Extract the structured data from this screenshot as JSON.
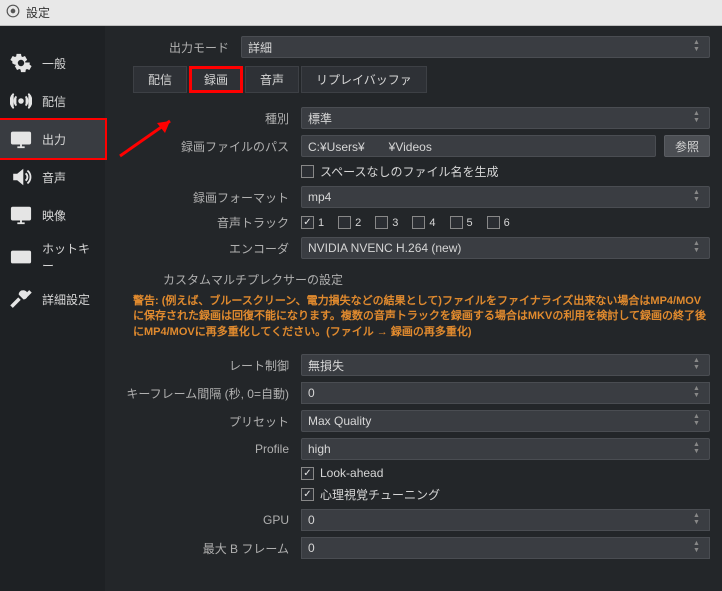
{
  "window": {
    "title": "設定"
  },
  "sidebar": {
    "items": [
      {
        "label": "一般",
        "icon": "gear-icon",
        "key": "general"
      },
      {
        "label": "配信",
        "icon": "broadcast-icon",
        "key": "stream"
      },
      {
        "label": "出力",
        "icon": "output-icon",
        "key": "output",
        "selected": true
      },
      {
        "label": "音声",
        "icon": "speaker-icon",
        "key": "audio"
      },
      {
        "label": "映像",
        "icon": "monitor-icon",
        "key": "video"
      },
      {
        "label": "ホットキー",
        "icon": "keyboard-icon",
        "key": "hotkeys"
      },
      {
        "label": "詳細設定",
        "icon": "tools-icon",
        "key": "advanced"
      }
    ]
  },
  "content": {
    "output_mode_label": "出力モード",
    "output_mode_value": "詳細",
    "tabs": [
      {
        "label": "配信",
        "key": "stream"
      },
      {
        "label": "録画",
        "key": "record",
        "active": true
      },
      {
        "label": "音声",
        "key": "audio"
      },
      {
        "label": "リプレイバッファ",
        "key": "replay"
      }
    ],
    "type_label": "種別",
    "type_value": "標準",
    "path_label": "録画ファイルのパス",
    "path_value": "C:¥Users¥　　¥Videos",
    "browse_label": "参照",
    "spaceless_label": "スペースなしのファイル名を生成",
    "spaceless_checked": false,
    "format_label": "録画フォーマット",
    "format_value": "mp4",
    "track_label": "音声トラック",
    "tracks": [
      {
        "n": "1",
        "on": true
      },
      {
        "n": "2",
        "on": false
      },
      {
        "n": "3",
        "on": false
      },
      {
        "n": "4",
        "on": false
      },
      {
        "n": "5",
        "on": false
      },
      {
        "n": "6",
        "on": false
      }
    ],
    "encoder_label": "エンコーダ",
    "encoder_value": "NVIDIA NVENC H.264 (new)",
    "muxer_section": "カスタムマルチプレクサーの設定",
    "warning_text": "警告: (例えば、ブルースクリーン、電力損失などの結果として)ファイルをファイナライズ出来ない場合はMP4/MOVに保存された録画は回復不能になります。複数の音声トラックを録画する場合はMKVの利用を検討して録画の終了後にMP4/MOVに再多重化してください。(ファイル → 録画の再多重化)",
    "rate_label": "レート制御",
    "rate_value": "無損失",
    "keyint_label": "キーフレーム間隔 (秒, 0=自動)",
    "keyint_value": "0",
    "preset_label": "プリセット",
    "preset_value": "Max Quality",
    "profile_label": "Profile",
    "profile_value": "high",
    "lookahead_label": "Look-ahead",
    "lookahead_checked": true,
    "psycho_label": "心理視覚チューニング",
    "psycho_checked": true,
    "gpu_label": "GPU",
    "gpu_value": "0",
    "bframes_label": "最大 B フレーム",
    "bframes_value": "0"
  }
}
